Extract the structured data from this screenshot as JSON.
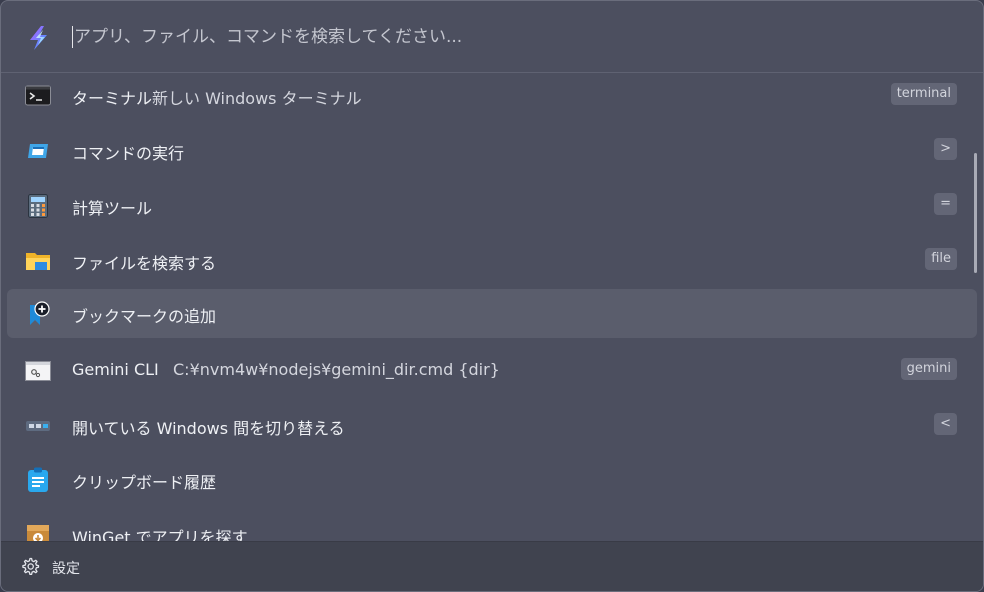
{
  "search": {
    "placeholder": "アプリ、ファイル、コマンドを検索してください..."
  },
  "results": [
    {
      "icon": "terminal-icon",
      "title": "ターミナル",
      "subtitle": "新しい Windows ターミナル",
      "badge": "terminal"
    },
    {
      "icon": "run-command-icon",
      "title": "コマンドの実行",
      "subtitle": "",
      "badge": ">"
    },
    {
      "icon": "calculator-icon",
      "title": "計算ツール",
      "subtitle": "",
      "badge": "="
    },
    {
      "icon": "folder-icon",
      "title": "ファイルを検索する",
      "subtitle": "",
      "badge": "file"
    },
    {
      "icon": "bookmark-add-icon",
      "title": "ブックマークの追加",
      "subtitle": "",
      "badge": ""
    },
    {
      "icon": "gemini-cli-icon",
      "title": "Gemini CLI",
      "subtitle": "C:¥nvm4w¥nodejs¥gemini_dir.cmd {dir}",
      "badge": "gemini"
    },
    {
      "icon": "window-switch-icon",
      "title": "開いている Windows 間を切り替える",
      "subtitle": "",
      "badge": "<"
    },
    {
      "icon": "clipboard-icon",
      "title": "クリップボード履歴",
      "subtitle": "",
      "badge": ""
    },
    {
      "icon": "winget-icon",
      "title": "WinGet でアプリを探す",
      "subtitle": "",
      "badge": ""
    }
  ],
  "selected_index": 4,
  "footer": {
    "settings_label": "設定",
    "settings_icon": "gear-icon"
  },
  "colors": {
    "background": "#4c4f5f",
    "selected_row": "#5a5d6c",
    "footer": "#40434f",
    "badge": "#636676"
  }
}
